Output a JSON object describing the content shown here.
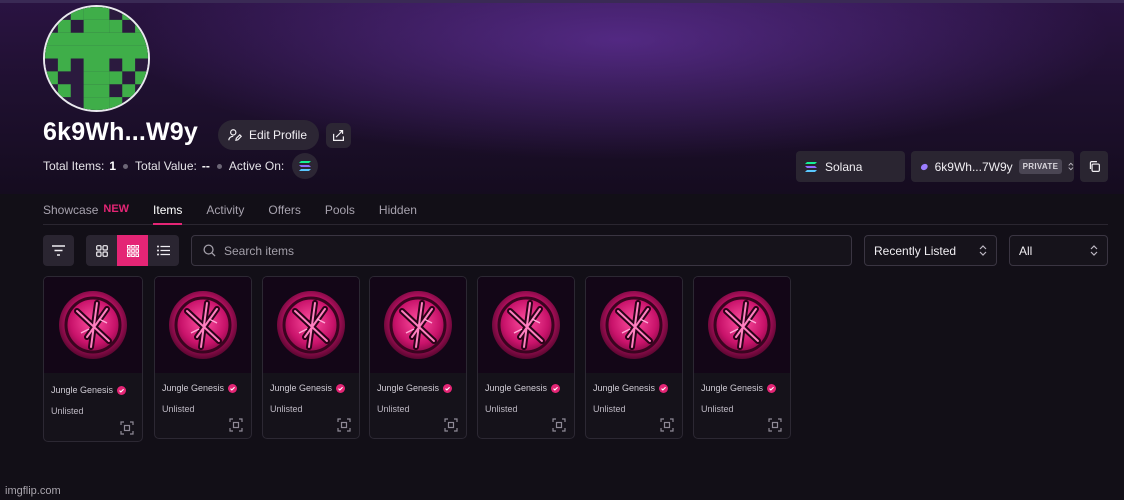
{
  "profile": {
    "name": "6k9Wh...W9y",
    "edit_label": "Edit Profile"
  },
  "stats": {
    "total_items_label": "Total Items:",
    "total_items_value": "1",
    "total_value_label": "Total Value:",
    "total_value_value": "--",
    "active_on_label": "Active On:"
  },
  "chain_select": {
    "label": "Solana"
  },
  "wallet_select": {
    "label": "6k9Wh...7W9y",
    "badge": "PRIVATE"
  },
  "tabs": [
    {
      "label": "Showcase",
      "badge": "NEW"
    },
    {
      "label": "Items",
      "active": true
    },
    {
      "label": "Activity"
    },
    {
      "label": "Offers"
    },
    {
      "label": "Pools"
    },
    {
      "label": "Hidden"
    }
  ],
  "search": {
    "placeholder": "Search items"
  },
  "sort": {
    "selected": "Recently Listed"
  },
  "filter": {
    "selected": "All"
  },
  "cards": [
    {
      "collection": "Jungle Genesis",
      "status": "Unlisted"
    },
    {
      "collection": "Jungle Genesis",
      "status": "Unlisted"
    },
    {
      "collection": "Jungle Genesis",
      "status": "Unlisted"
    },
    {
      "collection": "Jungle Genesis",
      "status": "Unlisted"
    },
    {
      "collection": "Jungle Genesis",
      "status": "Unlisted"
    },
    {
      "collection": "Jungle Genesis",
      "status": "Unlisted"
    },
    {
      "collection": "Jungle Genesis",
      "status": "Unlisted"
    }
  ],
  "watermark": "imgflip.com",
  "colors": {
    "accent": "#e42575",
    "background": "#120f17",
    "avatar_green": "#3fae49",
    "avatar_dark": "#2b1a3e"
  }
}
